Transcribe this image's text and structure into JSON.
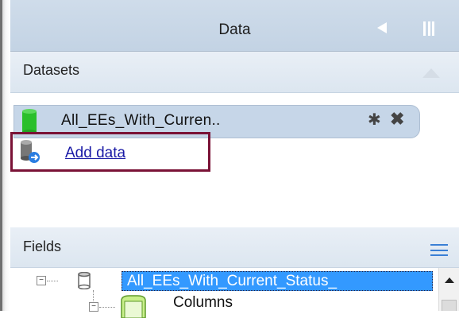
{
  "panel": {
    "title": "Data"
  },
  "datasets": {
    "title": "Datasets",
    "items": [
      {
        "label": "All_EEs_With_Curren..",
        "icon": "database-green-icon",
        "color": "#2bbf2b"
      }
    ],
    "add_data_label": "Add data",
    "highlight_color": "#7a1236"
  },
  "fields": {
    "title": "Fields",
    "tree": {
      "root_label": "All_EEs_With_Current_Status_",
      "root_selected": true,
      "child_label": "Columns"
    }
  },
  "colors": {
    "header": "#c9d8e8",
    "section": "#e2eaf3",
    "selection": "#3399ff",
    "link": "#1a1aa6"
  }
}
